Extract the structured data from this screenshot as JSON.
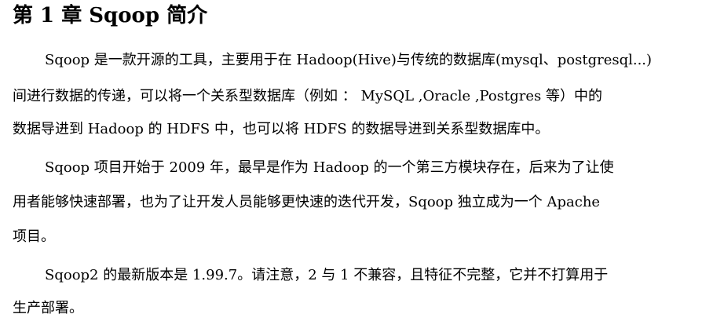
{
  "document": {
    "title": "第 1 章  Sqoop 简介",
    "lines": [
      "Sqoop 是一款开源的工具，主要用于在 Hadoop(Hive)与传统的数据库(mysql、postgresql...)",
      "间进行数据的传递，可以将一个关系型数据库（例如 ：  MySQL ,Oracle ,Postgres 等）中的",
      "数据导进到 Hadoop 的 HDFS 中，也可以将 HDFS 的数据导进到关系型数据库中。",
      "Sqoop 项目开始于 2009 年，最早是作为 Hadoop 的一个第三方模块存在，后来为了让使",
      "用者能够快速部署，也为了让开发人员能够更快速的迭代开发，Sqoop 独立成为一个 Apache",
      "项目。",
      "Sqoop2 的最新版本是 1.99.7。请注意，2 与 1 不兼容，且特征不完整，它并不打算用于",
      "生产部署。"
    ]
  }
}
